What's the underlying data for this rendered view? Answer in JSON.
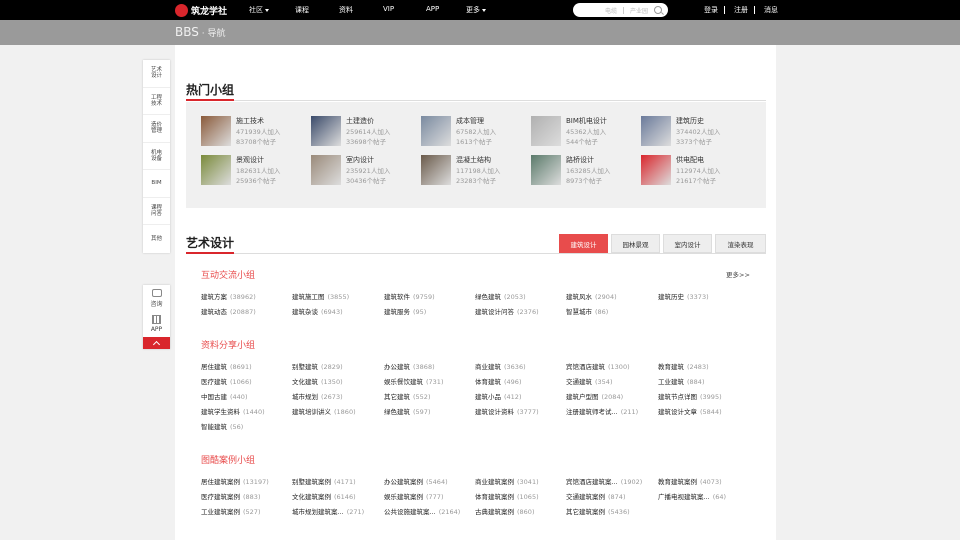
{
  "topbar": {
    "logo": "筑龙学社",
    "nav": [
      "社区",
      "课程",
      "资料",
      "VIP",
      "APP",
      "更多"
    ],
    "search": {
      "opt1": "电缆",
      "opt2": "产业园"
    },
    "user": [
      "登录",
      "注册",
      "消息"
    ]
  },
  "breadcrumb": {
    "main": "BBS",
    "sep": " · ",
    "sub": "导航"
  },
  "sidenav": [
    "艺术设计",
    "工程技术",
    "造价管理",
    "机电设备",
    "BIM",
    "课程问答",
    "其他"
  ],
  "sidetools": {
    "consult": "咨询",
    "app": "APP"
  },
  "hot": {
    "title": "热门小组",
    "groups": [
      {
        "name": "施工技术",
        "members": "471939人加入",
        "posts": "83708个帖子",
        "color": "#8a5a3a"
      },
      {
        "name": "土建造价",
        "members": "259614人加入",
        "posts": "33698个帖子",
        "color": "#3a4a6a"
      },
      {
        "name": "成本管理",
        "members": "67582人加入",
        "posts": "1613个帖子",
        "color": "#7a8aa0"
      },
      {
        "name": "BIM机电设计",
        "members": "45362人加入",
        "posts": "544个帖子",
        "color": "#b0b0b0"
      },
      {
        "name": "建筑历史",
        "members": "374402人加入",
        "posts": "3373个帖子",
        "color": "#6a7a9a"
      },
      {
        "name": "景观设计",
        "members": "182631人加入",
        "posts": "25936个帖子",
        "color": "#7a8a3a"
      },
      {
        "name": "室内设计",
        "members": "235921人加入",
        "posts": "30436个帖子",
        "color": "#9a8a7a"
      },
      {
        "name": "混凝土结构",
        "members": "117198人加入",
        "posts": "23283个帖子",
        "color": "#6a5a4a"
      },
      {
        "name": "路桥设计",
        "members": "163285人加入",
        "posts": "8973个帖子",
        "color": "#5a7a6a"
      },
      {
        "name": "供电配电",
        "members": "112974人加入",
        "posts": "21617个帖子",
        "color": "#d9262c"
      }
    ]
  },
  "art": {
    "title": "艺术设计",
    "tabs": [
      "建筑设计",
      "园林景观",
      "室内设计",
      "渲染表现"
    ],
    "more": "更多>>",
    "sections": [
      {
        "title": "互动交流小组",
        "rows": [
          [
            [
              "建筑方案",
              "(38962)"
            ],
            [
              "建筑施工图",
              "(3855)"
            ],
            [
              "建筑软件",
              "(9759)"
            ],
            [
              "绿色建筑",
              "(2053)"
            ],
            [
              "建筑风水",
              "(2904)"
            ],
            [
              "建筑历史",
              "(3373)"
            ]
          ],
          [
            [
              "建筑动态",
              "(20887)"
            ],
            [
              "建筑杂谈",
              "(6943)"
            ],
            [
              "建筑服务",
              "(95)"
            ],
            [
              "建筑设计问答",
              "(2376)"
            ],
            [
              "智慧城市",
              "(86)"
            ]
          ]
        ]
      },
      {
        "title": "资料分享小组",
        "rows": [
          [
            [
              "居住建筑",
              "(8691)"
            ],
            [
              "别墅建筑",
              "(2829)"
            ],
            [
              "办公建筑",
              "(3868)"
            ],
            [
              "商业建筑",
              "(3636)"
            ],
            [
              "宾馆酒店建筑",
              "(1300)"
            ],
            [
              "教育建筑",
              "(2483)"
            ]
          ],
          [
            [
              "医疗建筑",
              "(1066)"
            ],
            [
              "文化建筑",
              "(1350)"
            ],
            [
              "娱乐餐饮建筑",
              "(731)"
            ],
            [
              "体育建筑",
              "(496)"
            ],
            [
              "交通建筑",
              "(354)"
            ],
            [
              "工业建筑",
              "(884)"
            ]
          ],
          [
            [
              "中国古建",
              "(440)"
            ],
            [
              "城市规划",
              "(2673)"
            ],
            [
              "其它建筑",
              "(552)"
            ],
            [
              "建筑小品",
              "(412)"
            ],
            [
              "建筑户型图",
              "(2084)"
            ],
            [
              "建筑节点详图",
              "(3995)"
            ]
          ],
          [
            [
              "建筑学生资料",
              "(1440)"
            ],
            [
              "建筑培训讲义",
              "(1860)"
            ],
            [
              "绿色建筑",
              "(597)"
            ],
            [
              "建筑设计资料",
              "(3777)"
            ],
            [
              "注册建筑师考试...",
              "(211)"
            ],
            [
              "建筑设计文章",
              "(5844)"
            ]
          ],
          [
            [
              "智能建筑",
              "(56)"
            ]
          ]
        ]
      },
      {
        "title": "图酷案例小组",
        "rows": [
          [
            [
              "居住建筑案例",
              "(13197)"
            ],
            [
              "别墅建筑案例",
              "(4171)"
            ],
            [
              "办公建筑案例",
              "(5464)"
            ],
            [
              "商业建筑案例",
              "(3041)"
            ],
            [
              "宾馆酒店建筑案...",
              "(1902)"
            ],
            [
              "教育建筑案例",
              "(4073)"
            ]
          ],
          [
            [
              "医疗建筑案例",
              "(883)"
            ],
            [
              "文化建筑案例",
              "(6146)"
            ],
            [
              "娱乐建筑案例",
              "(777)"
            ],
            [
              "体育建筑案例",
              "(1065)"
            ],
            [
              "交通建筑案例",
              "(874)"
            ],
            [
              "广播电视建筑案...",
              "(64)"
            ]
          ],
          [
            [
              "工业建筑案例",
              "(527)"
            ],
            [
              "城市规划建筑案...",
              "(271)"
            ],
            [
              "公共设施建筑案...",
              "(2164)"
            ],
            [
              "古典建筑案例",
              "(860)"
            ],
            [
              "其它建筑案例",
              "(5436)"
            ]
          ]
        ]
      }
    ]
  }
}
